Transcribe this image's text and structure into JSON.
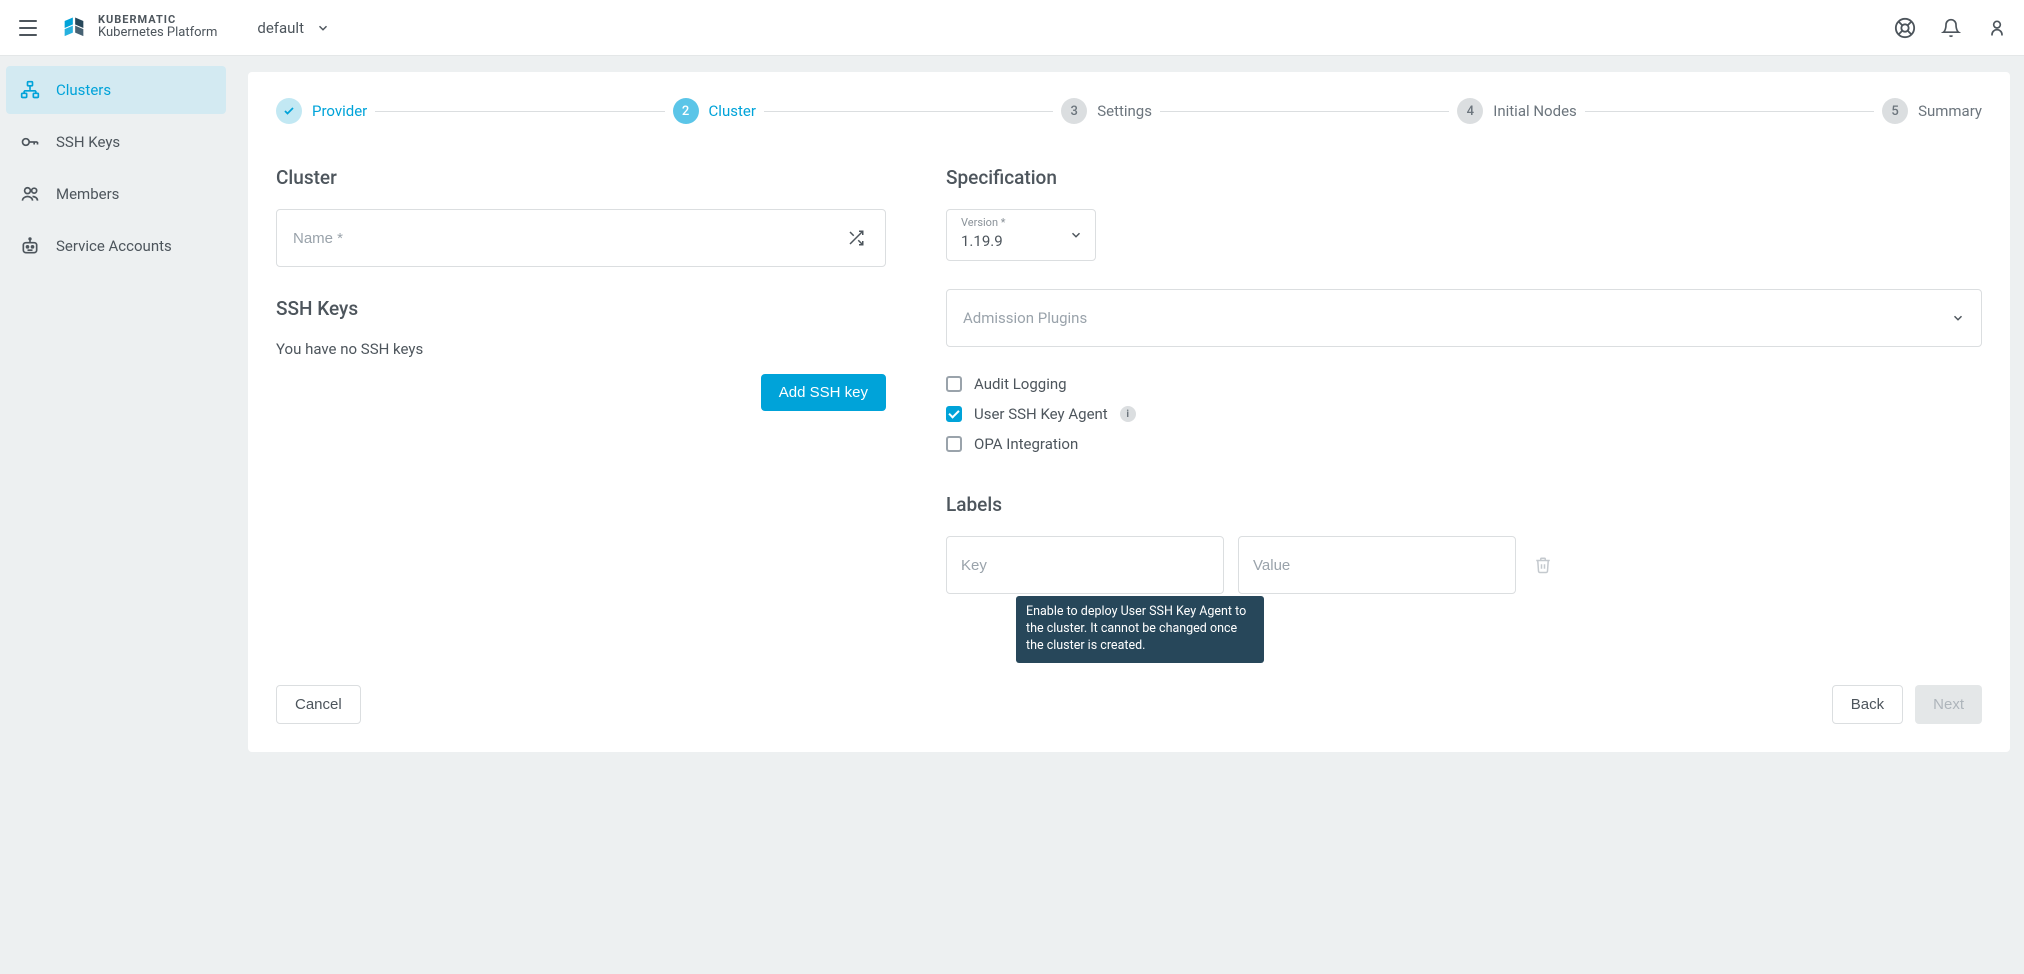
{
  "header": {
    "brand_top": "KUBERMATIC",
    "brand_sub": "Kubernetes Platform",
    "project": "default"
  },
  "sidebar": {
    "items": [
      {
        "id": "clusters",
        "label": "Clusters"
      },
      {
        "id": "ssh-keys",
        "label": "SSH Keys"
      },
      {
        "id": "members",
        "label": "Members"
      },
      {
        "id": "service-accounts",
        "label": "Service Accounts"
      }
    ],
    "active": "clusters"
  },
  "stepper": {
    "steps": [
      {
        "num": "1",
        "label": "Provider",
        "state": "done"
      },
      {
        "num": "2",
        "label": "Cluster",
        "state": "active"
      },
      {
        "num": "3",
        "label": "Settings",
        "state": "pending"
      },
      {
        "num": "4",
        "label": "Initial Nodes",
        "state": "pending"
      },
      {
        "num": "5",
        "label": "Summary",
        "state": "pending"
      }
    ]
  },
  "cluster": {
    "heading": "Cluster",
    "name_placeholder": "Name *"
  },
  "ssh": {
    "heading": "SSH Keys",
    "empty_text": "You have no SSH keys",
    "add_button": "Add SSH key"
  },
  "spec": {
    "heading": "Specification",
    "version_label": "Version *",
    "version_value": "1.19.9",
    "admission_placeholder": "Admission Plugins",
    "options": {
      "audit_logging": {
        "label": "Audit Logging",
        "checked": false
      },
      "user_ssh_key_agent": {
        "label": "User SSH Key Agent",
        "checked": true,
        "tooltip": "Enable to deploy User SSH Key Agent to the cluster. It cannot be changed once the cluster is created."
      },
      "opa_integration": {
        "label": "OPA Integration",
        "checked": false
      }
    }
  },
  "labels": {
    "heading": "Labels",
    "key_placeholder": "Key",
    "value_placeholder": "Value"
  },
  "footer": {
    "cancel": "Cancel",
    "back": "Back",
    "next": "Next"
  }
}
